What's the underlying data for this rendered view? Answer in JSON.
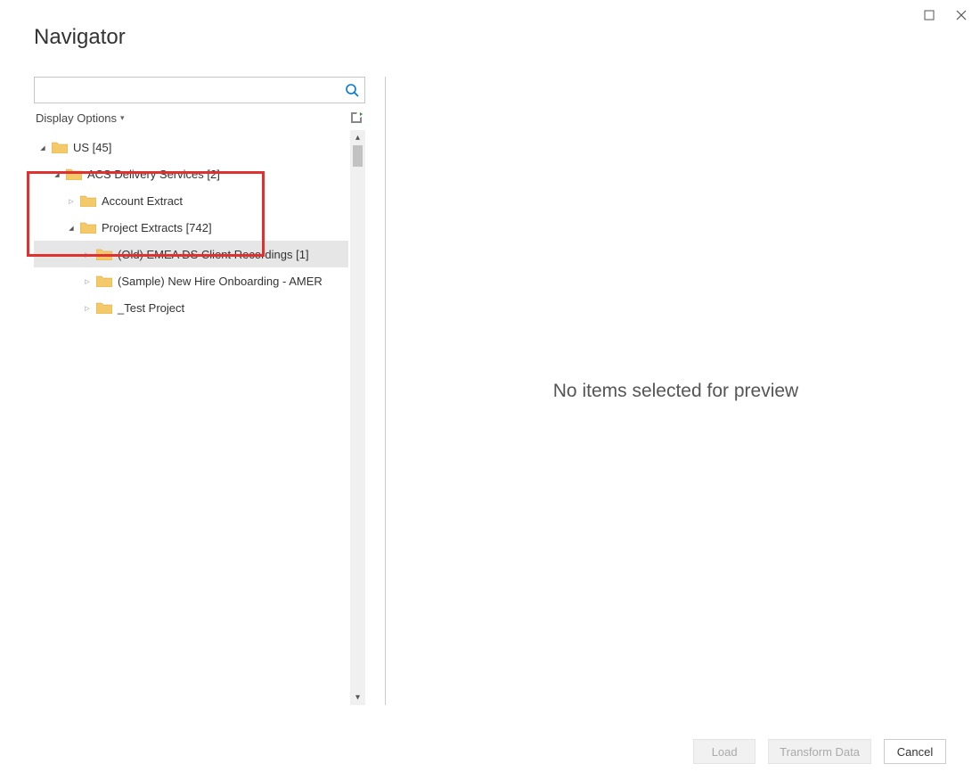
{
  "window": {
    "title": "Navigator"
  },
  "search": {
    "placeholder": ""
  },
  "display_options_label": "Display Options",
  "tree": [
    {
      "level": 0,
      "expanded": true,
      "selected": false,
      "label": "US [45]"
    },
    {
      "level": 1,
      "expanded": true,
      "selected": false,
      "label": "ACS Delivery Services [2]"
    },
    {
      "level": 2,
      "expanded": false,
      "selected": false,
      "label": "Account Extract"
    },
    {
      "level": 2,
      "expanded": true,
      "selected": false,
      "label": "Project Extracts [742]"
    },
    {
      "level": 3,
      "expanded": false,
      "selected": true,
      "label": "(Old) EMEA DS Client Recordings [1]"
    },
    {
      "level": 3,
      "expanded": false,
      "selected": false,
      "label": "(Sample) New Hire Onboarding - AMER"
    },
    {
      "level": 3,
      "expanded": false,
      "selected": false,
      "label": "_Test Project"
    }
  ],
  "preview": {
    "empty_message": "No items selected for preview"
  },
  "buttons": {
    "load": "Load",
    "transform": "Transform Data",
    "cancel": "Cancel"
  }
}
